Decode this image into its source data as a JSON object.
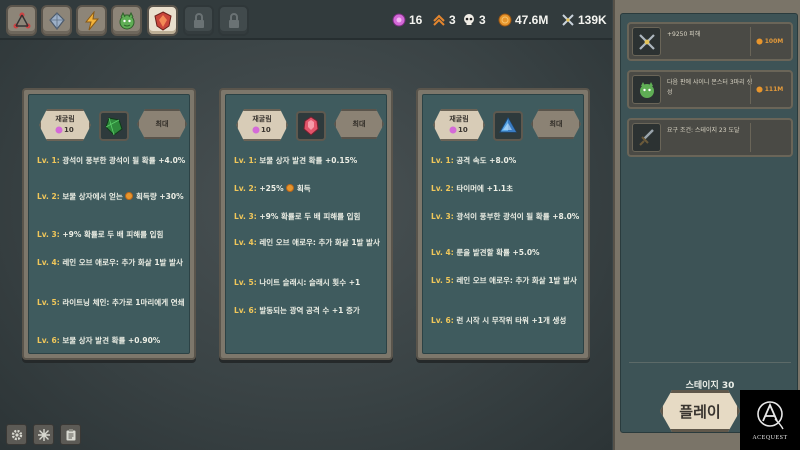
{
  "topbar": {
    "tabs": [
      {
        "icon": "nodes-icon",
        "state": "normal"
      },
      {
        "icon": "gem-icon",
        "state": "normal"
      },
      {
        "icon": "lightning-icon",
        "state": "normal"
      },
      {
        "icon": "dragon-icon",
        "state": "normal"
      },
      {
        "icon": "crystal-shield-icon",
        "state": "active"
      },
      {
        "icon": "lock-icon",
        "state": "locked"
      },
      {
        "icon": "lock-icon",
        "state": "locked"
      }
    ],
    "resources": [
      {
        "icon": "pink-gem-icon",
        "value": "16"
      },
      {
        "icon": "rank-chevron-icon",
        "value": "3"
      },
      {
        "icon": "skull-icon",
        "value": "3"
      },
      {
        "icon": "gold-coin-icon",
        "value": "47.6M"
      },
      {
        "icon": "sword-crossed-icon",
        "value": "139K"
      }
    ]
  },
  "cards": [
    {
      "cost_label": "재굴림",
      "cost_value": "10",
      "icon": "green-crystal-icon",
      "max_label": "최대",
      "levels": [
        {
          "lv": "Lv. 1:",
          "text": "광석이 풍부한 광석이 될 확률 +4.0%"
        },
        {
          "lv": "Lv. 2:",
          "text_before": "보물 상자에서 얻는",
          "text_after": "획득량 +30%"
        },
        {
          "lv": "Lv. 3:",
          "text": "+9% 확률로 두 배 피해를 입힘"
        },
        {
          "lv": "Lv. 4:",
          "text": "레인 오브 애로우: 추가 화살 1발 발사"
        },
        {
          "lv": "Lv. 5:",
          "text": "라이트닝 체인: 추가로 1마리에게 연쇄"
        },
        {
          "lv": "Lv. 6:",
          "text": "보물 상자 발견 확률 +0.90%"
        }
      ]
    },
    {
      "cost_label": "재굴림",
      "cost_value": "10",
      "icon": "red-gem-icon",
      "max_label": "최대",
      "levels": [
        {
          "lv": "Lv. 1:",
          "text": "보물 상자 발견 확률 +0.15%"
        },
        {
          "lv": "Lv. 2:",
          "text_before": "+25%",
          "text_after": "획득"
        },
        {
          "lv": "Lv. 3:",
          "text": "+9% 확률로 두 배 피해를 입힘"
        },
        {
          "lv": "Lv. 4:",
          "text": "레인 오브 애로우: 추가 화살 1발 발사"
        },
        {
          "lv": "Lv. 5:",
          "text": "나이트 슬래시: 슬래시 횟수 +1"
        },
        {
          "lv": "Lv. 6:",
          "text": "발동되는 광역 공격 수 +1 증가"
        }
      ]
    },
    {
      "cost_label": "재굴림",
      "cost_value": "10",
      "icon": "blue-pyramid-icon",
      "max_label": "최대",
      "levels": [
        {
          "lv": "Lv. 1:",
          "text": "공격 속도 +8.0%"
        },
        {
          "lv": "Lv. 2:",
          "text": "타이머에 +1.1초"
        },
        {
          "lv": "Lv. 3:",
          "text": "광석이 풍부한 광석이 될 확률 +8.0%"
        },
        {
          "lv": "Lv. 4:",
          "text": "룬을 발견할 확률 +5.0%"
        },
        {
          "lv": "Lv. 5:",
          "text": "레인 오브 애로우: 추가 화살 1발 발사"
        },
        {
          "lv": "Lv. 6:",
          "text": "런 시작 시 무작위 타워 +1개 생성"
        }
      ]
    }
  ],
  "quests": [
    {
      "icon": "crossed-swords-icon",
      "text": "+9250 피해",
      "reward": "100M"
    },
    {
      "icon": "green-monster-icon",
      "text": "다음 판에 샤이니 몬스터 3마리 생성",
      "reward": "111M"
    },
    {
      "icon": "sword-icon",
      "text": "요구 조건: 스테이지 23 도달",
      "reward": ""
    }
  ],
  "stage_label": "스테이지 30",
  "play_label": "플레이",
  "utility_buttons": [
    "settings-gear-icon",
    "snowflake-icon",
    "clipboard-icon"
  ],
  "logo_text": "ACEQUEST",
  "colors": {
    "gold": "#f0c75a",
    "coin": "#e7952c",
    "panel": "#3f5b5e",
    "frame": "#7d776b"
  }
}
